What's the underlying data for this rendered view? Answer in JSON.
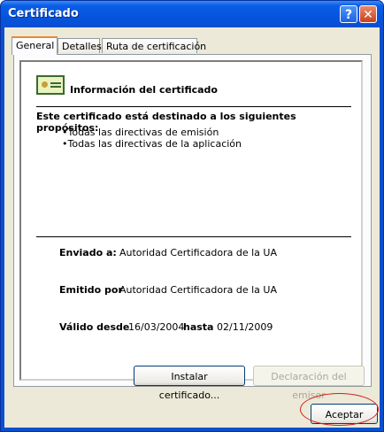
{
  "window": {
    "title": "Certificado"
  },
  "tabs": [
    {
      "label": "General"
    },
    {
      "label": "Detalles"
    },
    {
      "label": "Ruta de certificación"
    }
  ],
  "info": {
    "title": "Información del certificado"
  },
  "purposes": {
    "heading": "Este certificado está destinado a los siguientes propósitos:",
    "items": [
      "•Todas las directivas de emisión",
      "•Todas las directivas de la aplicación"
    ]
  },
  "fields": {
    "issued_to_label": "Enviado a:",
    "issued_to_value": "Autoridad Certificadora de la UA",
    "issued_by_label": "Emitido por",
    "issued_by_value": "Autoridad Certificadora de la UA",
    "valid_from_label": "Válido desde",
    "valid_from_value": "16/03/2004",
    "valid_to_label": "hasta",
    "valid_to_value": "02/11/2009"
  },
  "buttons": {
    "install": "Instalar certificado...",
    "issuer_statement": "Declaración del emisor",
    "ok": "Aceptar"
  },
  "titlebar_buttons": {
    "help": "?",
    "close": "✕"
  },
  "colors": {
    "titlebar": "#0554dd",
    "highlight_oval": "#d02020",
    "tab_accent": "#e68b2c"
  }
}
